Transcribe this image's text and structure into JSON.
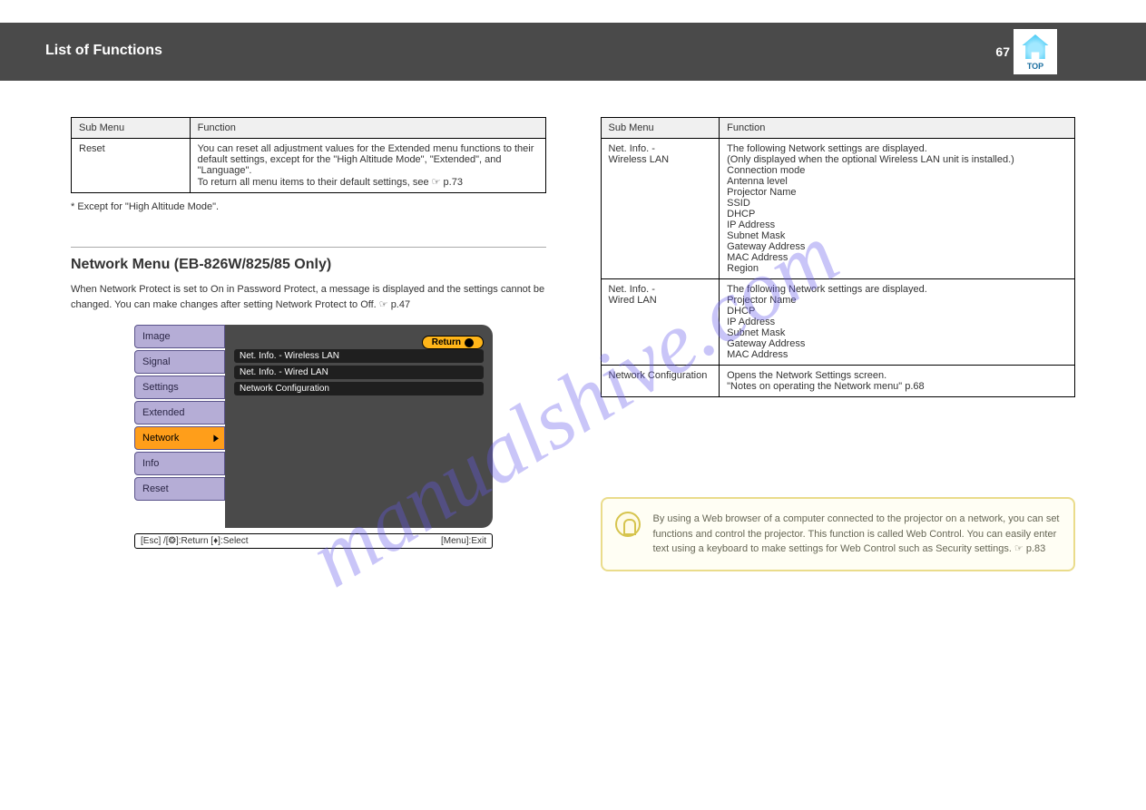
{
  "watermark": "manualshive.com",
  "header": {
    "title": "List of Functions",
    "page": "67",
    "top_label": "TOP"
  },
  "left": {
    "table1": {
      "headers": [
        "Sub Menu",
        "Function"
      ],
      "rows": [
        {
          "c0": "Reset",
          "c1": "You can reset all adjustment values for the Extended menu functions to their default settings, except for the \"High Altitude Mode\", \"Extended\", and \"Language\".\nTo return all menu items to their default settings, see ☞ p.73"
        }
      ]
    },
    "footnote": "* Except for \"High Altitude Mode\".",
    "section_title": "Network Menu (EB-826W/825/85 Only)",
    "para": "When Network Protect is set to On in Password Protect, a message is displayed and the settings cannot be changed. You can make changes after setting Network Protect to Off. ☞ p.47",
    "menu": {
      "tabs": [
        "Image",
        "Signal",
        "Settings",
        "Extended",
        "Network",
        "Info",
        "Reset"
      ],
      "active_tab": "Network",
      "return_label": "Return",
      "items": [
        "Net. Info. - Wireless LAN",
        "Net. Info. - Wired LAN",
        "Network Configuration"
      ],
      "footer_left": "[Esc] /[❂]:Return  [♦]:Select",
      "footer_right": "[Menu]:Exit"
    }
  },
  "right": {
    "table2": {
      "headers": [
        "Sub Menu",
        "Function"
      ],
      "rows": [
        {
          "c0": "Net. Info. -\nWireless LAN",
          "c1": "The following Network settings are displayed.\n(Only displayed when the optional Wireless LAN unit is installed.)\nConnection mode\nAntenna level\nProjector Name\nSSID\nDHCP\nIP Address\nSubnet Mask\nGateway Address\nMAC Address\nRegion"
        },
        {
          "c0": "Net. Info. -\nWired LAN",
          "c1": "The following Network settings are displayed.\nProjector Name\nDHCP\nIP Address\nSubnet Mask\nGateway Address\nMAC Address"
        },
        {
          "c0": "Network Configuration",
          "c1": "Opens the Network Settings screen.\n\"Notes on operating the Network menu\" p.68"
        }
      ]
    },
    "tip": "By using a Web browser of a computer connected to the projector on a network, you can set functions and control the projector. This function is called Web Control. You can easily enter text using a keyboard to make settings for Web Control such as Security settings. ☞ p.83"
  }
}
